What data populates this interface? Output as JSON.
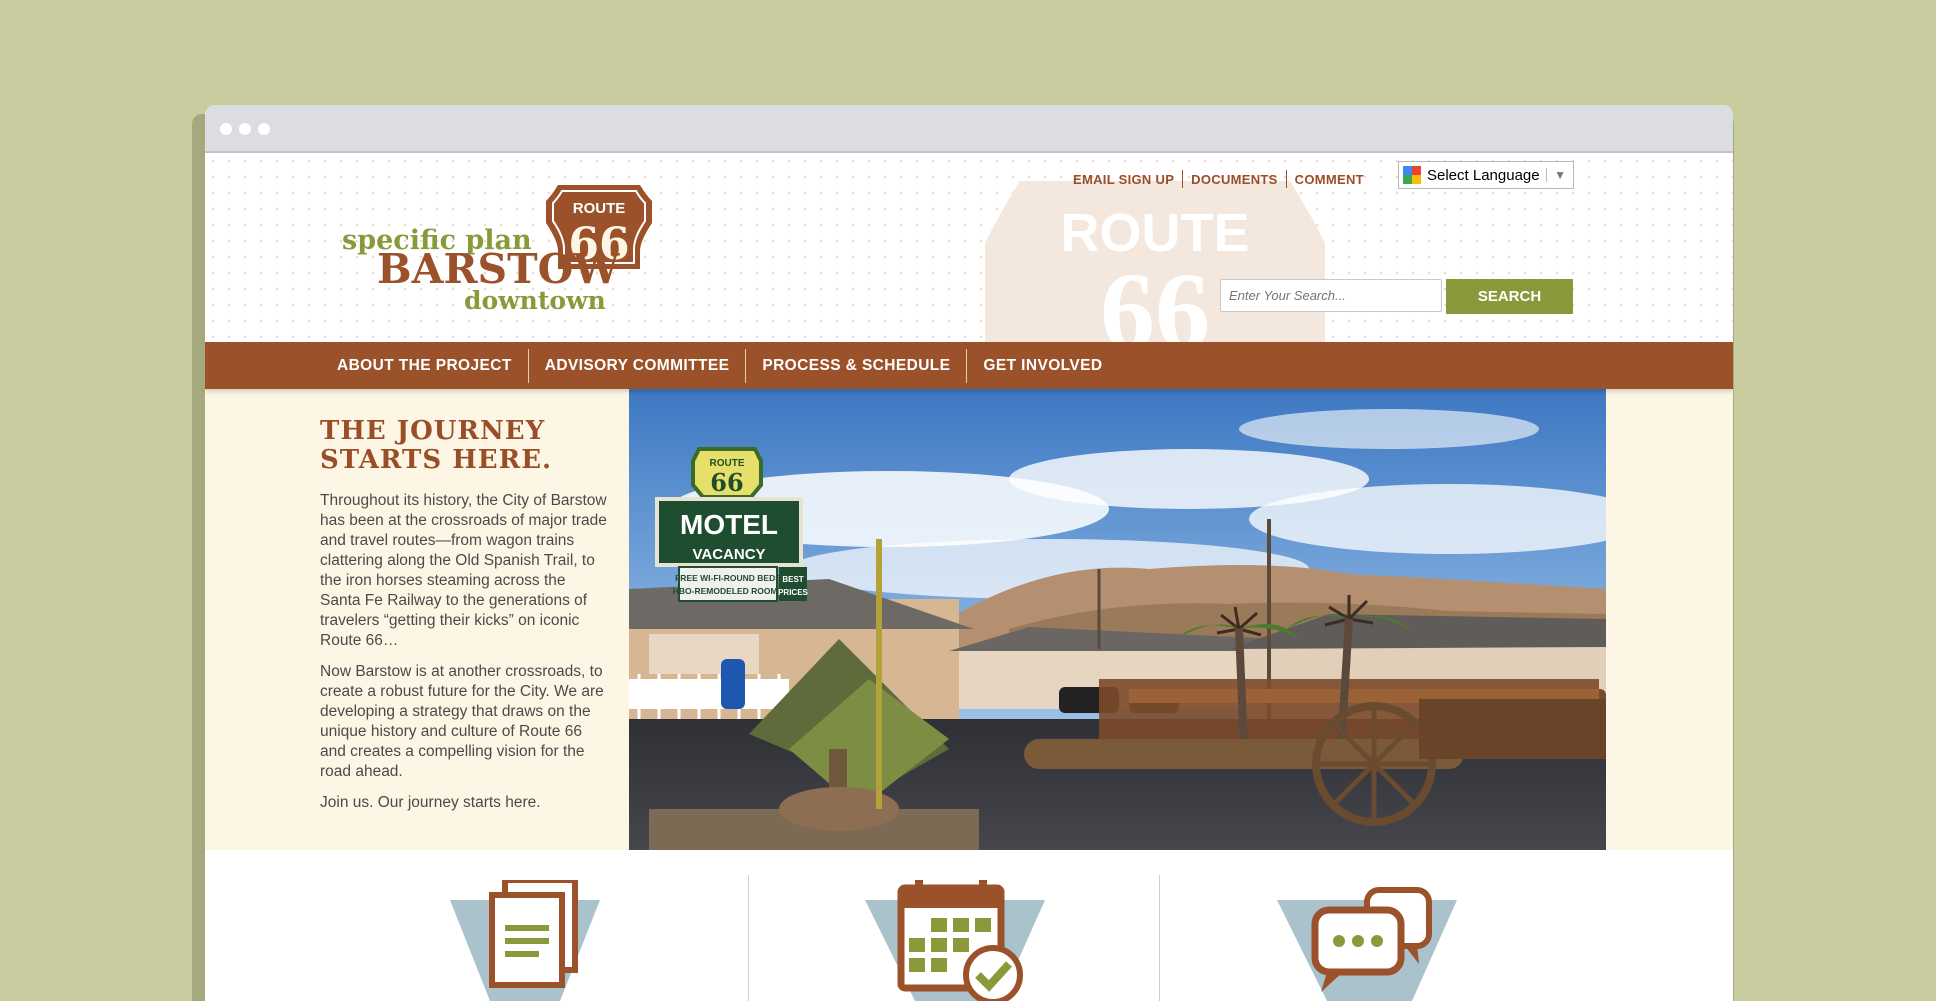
{
  "header": {
    "logo": {
      "line1": "specific plan",
      "line2": "BARSTOW",
      "line3": "downtown",
      "route_text": "ROUTE",
      "route_number": "66"
    },
    "watermark_text": "ROUTE",
    "top_links": [
      "EMAIL SIGN UP",
      "DOCUMENTS",
      "COMMENT"
    ],
    "language": "Select Language",
    "search": {
      "placeholder": "Enter Your Search...",
      "button": "SEARCH"
    }
  },
  "nav": {
    "items": [
      "ABOUT THE PROJECT",
      "ADVISORY COMMITTEE",
      "PROCESS & SCHEDULE",
      "GET INVOLVED"
    ]
  },
  "hero": {
    "title_line1": "THE JOURNEY",
    "title_line2": "STARTS HERE.",
    "paragraphs": [
      "Throughout its history, the City of Barstow has been at the crossroads of major trade and travel routes—from wagon trains clattering along the Old Spanish Trail, to the iron horses steaming across the Santa Fe Railway to the generations of travelers “getting their kicks” on iconic Route 66…",
      "Now Barstow is at another crossroads, to create a robust future for the City. We are developing a strategy that draws on the unique history and culture of Route 66 and creates a compelling vision for the road ahead.",
      "Join us. Our journey starts here."
    ],
    "photo_sign": {
      "route_text": "ROUTE",
      "route_number": "66",
      "motel": "MOTEL",
      "vacancy": "VACANCY",
      "amenity1": "FREE WI-FI-ROUND BEDS",
      "amenity2": "HBO-REMODELED ROOMS",
      "best1": "BEST",
      "best2": "PRICES"
    }
  },
  "features": {
    "icons": [
      "documents-icon",
      "calendar-check-icon",
      "comment-bubbles-icon"
    ],
    "colors": {
      "brown": "#9b522b",
      "green": "#8a9a3a",
      "blue": "#a9c2cc"
    }
  },
  "colors": {
    "background": "#c8cc9f",
    "nav": "#9b522b",
    "accent_green": "#8a9a3a",
    "hero_bg": "#fdf6e4"
  }
}
